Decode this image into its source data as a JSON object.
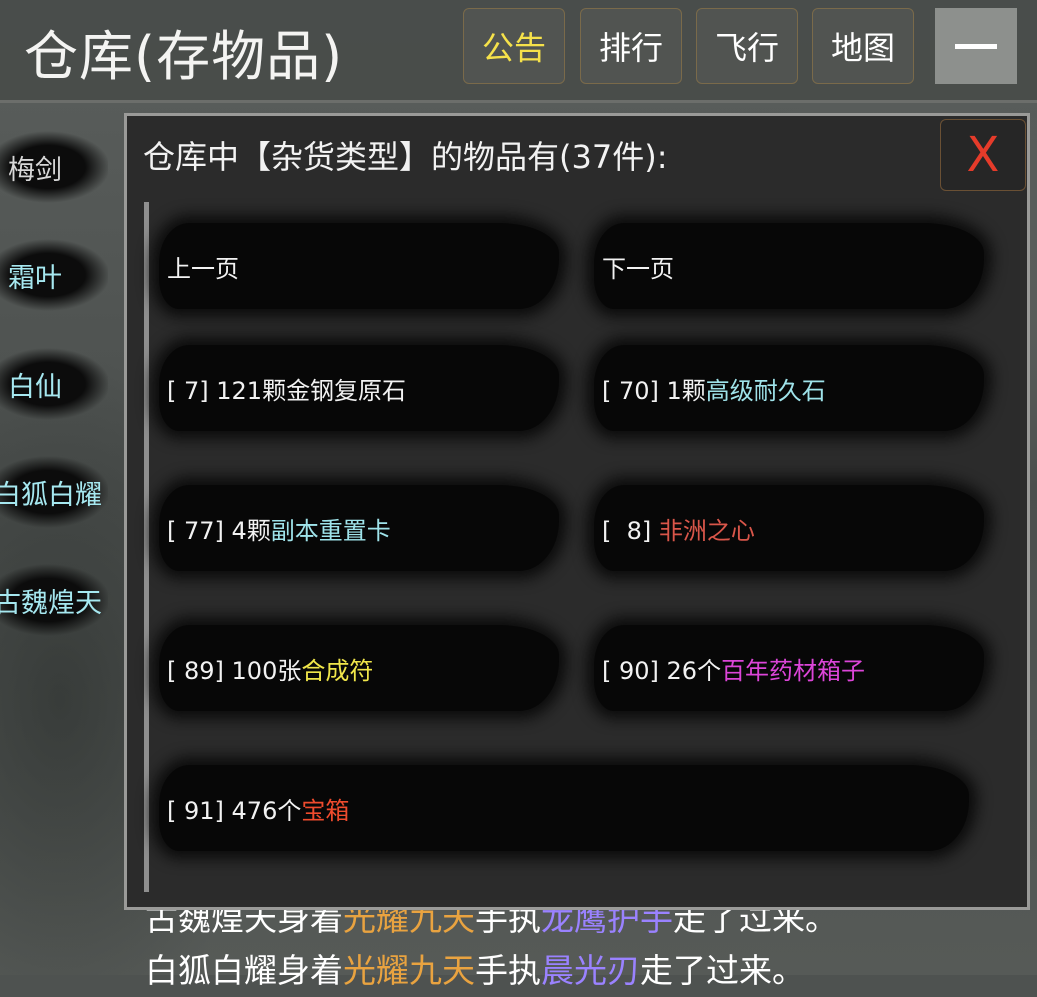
{
  "header": {
    "title": "仓库(存物品)",
    "buttons": [
      "公告",
      "排行",
      "飞行",
      "地图"
    ]
  },
  "sidebar": {
    "items": [
      "梅剑",
      "霜叶",
      "白仙",
      "白狐白耀",
      "古魏煌天"
    ]
  },
  "story": {
    "line1": {
      "prefix": "古魏煌天身着",
      "armor": "光耀九天",
      "mid": "手执",
      "weapon": "龙鹰护手",
      "suffix": "走了过来。"
    },
    "line2": {
      "prefix": "白狐白耀身着",
      "armor": "光耀九天",
      "mid": "手执",
      "weapon": "晨光刃",
      "suffix": "走了过来。"
    }
  },
  "dialog": {
    "title": "仓库中【杂货类型】的物品有(37件):",
    "close_label": "X",
    "prev_page": "上一页",
    "next_page": "下一页",
    "items": [
      {
        "prefix": "[  7] 121颗",
        "name": "金钢复原石",
        "color": "#f2f2f2"
      },
      {
        "prefix": "[ 70] 1颗",
        "name": "高级耐久石",
        "color": "#9fe3ea"
      },
      {
        "prefix": "[ 77] 4颗",
        "name": "副本重置卡",
        "color": "#9fe3ea"
      },
      {
        "prefix": "[  8] ",
        "name": "非洲之心",
        "color": "#d9564a"
      },
      {
        "prefix": "[ 89] 100张",
        "name": "合成符",
        "color": "#f0e64a"
      },
      {
        "prefix": "[ 90] 26个",
        "name": "百年药材箱子",
        "color": "#dc45d8"
      },
      {
        "prefix": "[ 91] 476个",
        "name": "宝箱",
        "color": "#ef4b2d"
      }
    ]
  }
}
